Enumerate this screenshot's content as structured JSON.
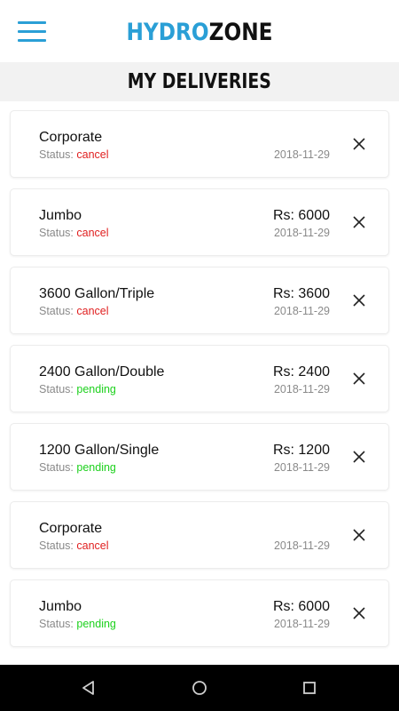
{
  "app": {
    "logo_part1": "HYDRO",
    "logo_part2": "ZONE"
  },
  "page": {
    "title": "MY DELIVERIES"
  },
  "colors": {
    "accent": "#2a9fd6",
    "status_cancel": "#e02020",
    "status_pending": "#1dd11d"
  },
  "deliveries": [
    {
      "name": "Corporate",
      "status_label": "Status: ",
      "status": "cancel",
      "price": "",
      "date": "2018-11-29"
    },
    {
      "name": "Jumbo",
      "status_label": "Status: ",
      "status": "cancel",
      "price": "Rs: 6000",
      "date": "2018-11-29"
    },
    {
      "name": "3600 Gallon/Triple",
      "status_label": "Status: ",
      "status": "cancel",
      "price": "Rs: 3600",
      "date": "2018-11-29"
    },
    {
      "name": "2400 Gallon/Double",
      "status_label": "Status: ",
      "status": "pending",
      "price": "Rs: 2400",
      "date": "2018-11-29"
    },
    {
      "name": "1200 Gallon/Single",
      "status_label": "Status: ",
      "status": "pending",
      "price": "Rs: 1200",
      "date": "2018-11-29"
    },
    {
      "name": "Corporate",
      "status_label": "Status: ",
      "status": "cancel",
      "price": "",
      "date": "2018-11-29"
    },
    {
      "name": "Jumbo",
      "status_label": "Status: ",
      "status": "pending",
      "price": "Rs: 6000",
      "date": "2018-11-29"
    }
  ],
  "icons": {
    "menu": "hamburger-menu-icon",
    "remove": "close-icon",
    "back": "back-triangle-icon",
    "home": "home-circle-icon",
    "recents": "recents-square-icon"
  }
}
